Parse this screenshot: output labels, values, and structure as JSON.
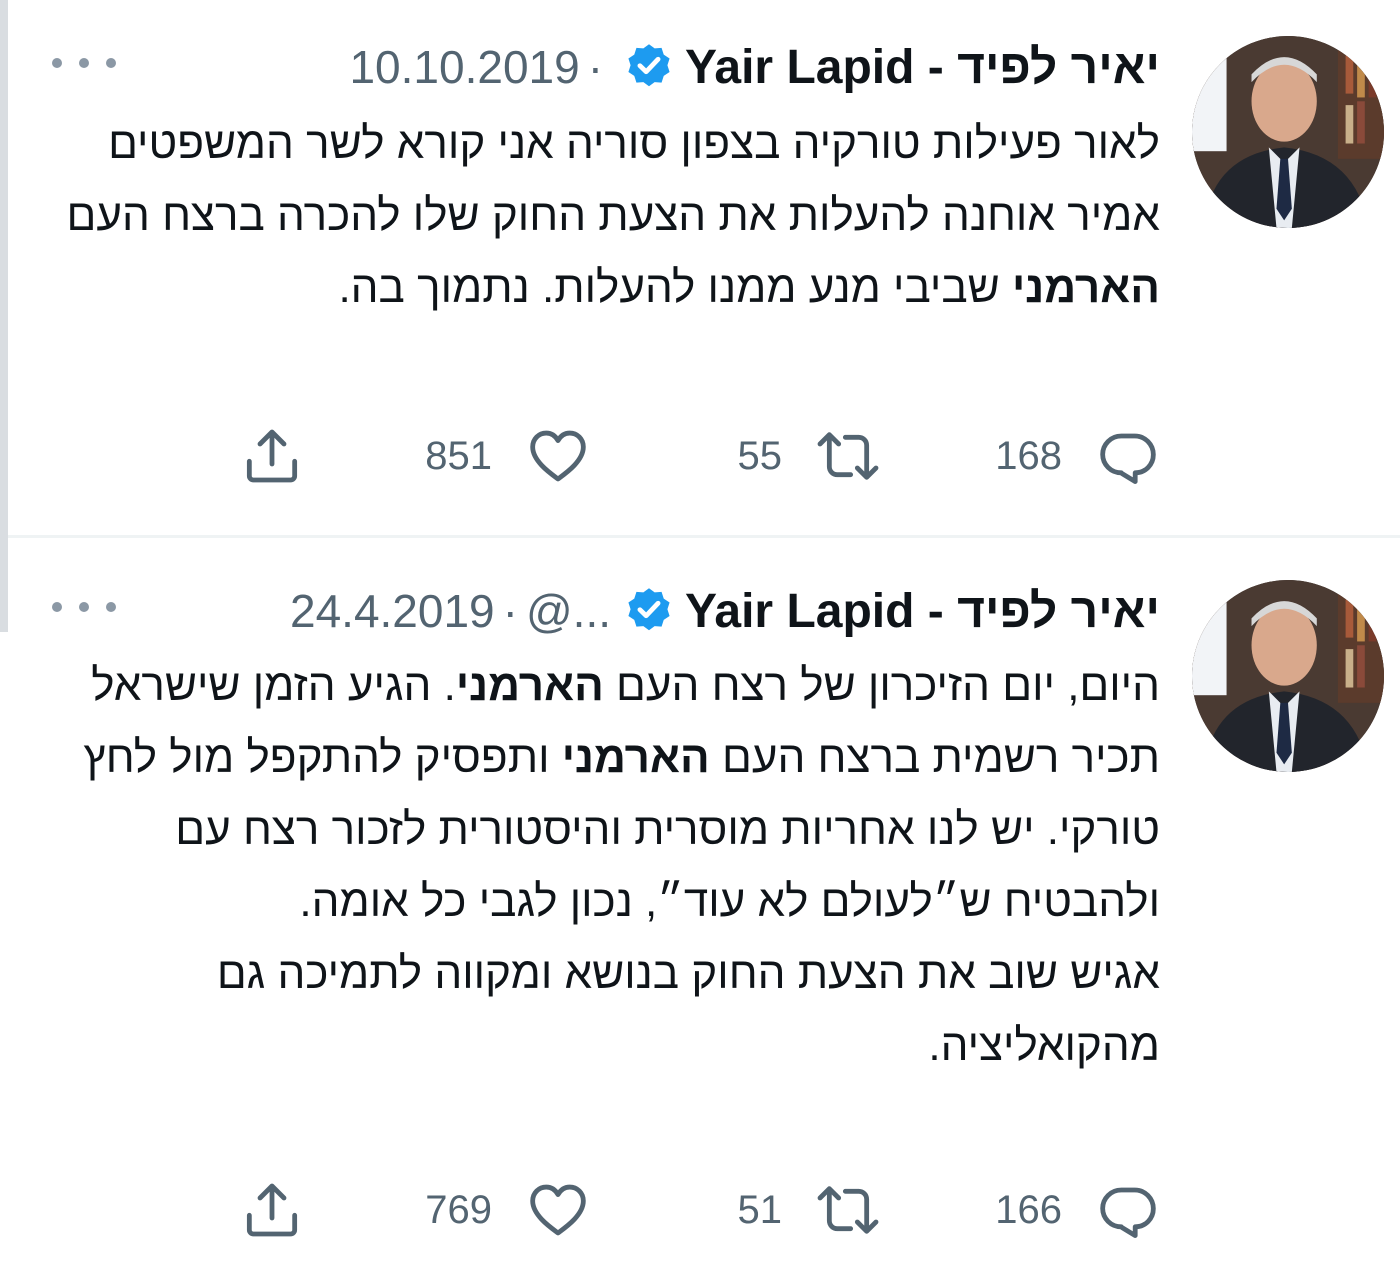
{
  "tweets": [
    {
      "name": "יאיר לפיד - Yair Lapid",
      "handle": "",
      "date": "10.10.2019",
      "body_parts": [
        "לאור פעילות טורקיה בצפון סוריה אני קורא לשר המשפטים אמיר אוחנה להעלות את הצעת החוק שלו להכרה ברצח העם ",
        "הארמני",
        " שביבי מנע ממנו להעלות. נתמוך בה."
      ],
      "stats": {
        "replies": "168",
        "retweets": "55",
        "likes": "851"
      }
    },
    {
      "name": "יאיר לפיד - Yair Lapid",
      "handle": "@...",
      "date": "24.4.2019",
      "body_parts": [
        "היום, יום הזיכרון של רצח העם ",
        "הארמני",
        ". הגיע הזמן שישראל תכיר רשמית ברצח העם ",
        "הארמני",
        " ותפסיק להתקפל מול לחץ טורקי. יש לנו אחריות מוסרית והיסטורית לזכור רצח עם ולהבטיח ש״לעולם לא עוד״, נכון לגבי כל אומה."
      ],
      "body_second_paragraph": "אגיש שוב את הצעת החוק בנושא ומקווה לתמיכה גם מהקואליציה.",
      "stats": {
        "replies": "166",
        "retweets": "51",
        "likes": "769"
      }
    }
  ],
  "icons": {
    "more": "more-horizontal-icon",
    "verified": "verified-badge-icon",
    "reply": "reply-icon",
    "retweet": "retweet-icon",
    "like": "heart-icon",
    "share": "share-icon"
  },
  "colors": {
    "text": "#0f1419",
    "muted": "#536471",
    "verified": "#1d9bf0",
    "divider": "#eff3f4"
  }
}
